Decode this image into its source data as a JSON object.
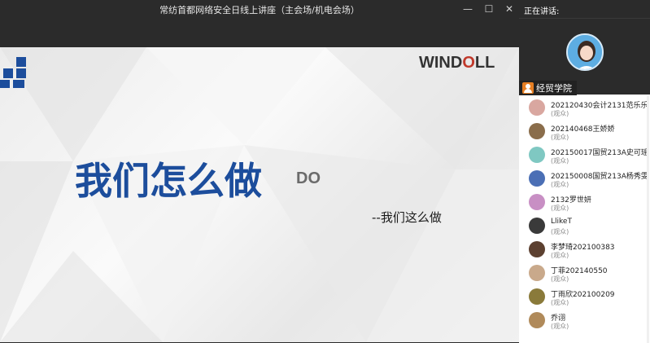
{
  "window": {
    "title": "常纺首都网络安全日线上讲座（主会场/机电会场）",
    "minimize_glyph": "—",
    "maximize_glyph": "☐",
    "close_glyph": "✕"
  },
  "slide": {
    "logo": {
      "prefix": "WIND",
      "accent": "O",
      "suffix": "LL"
    },
    "headline": "我们怎么做",
    "tag": "DO",
    "subtitle": "--我们这么做"
  },
  "panel": {
    "speaking_label": "正在讲话:",
    "speaker_name": "经贸学院",
    "audience": [
      {
        "name": "202120430会计2131范乐乐",
        "role": "(观众)",
        "color": "#d9a7a0"
      },
      {
        "name": "202140468王娇娇",
        "role": "(观众)",
        "color": "#8a6d4b"
      },
      {
        "name": "202150017国贸213A史可瑶",
        "role": "(观众)",
        "color": "#7fc8c2"
      },
      {
        "name": "202150008国贸213A杨秀雯",
        "role": "(观众)",
        "color": "#4b6fb5"
      },
      {
        "name": "2132罗世妍",
        "role": "(观众)",
        "color": "#c88fc4"
      },
      {
        "name": "LlikeT",
        "role": "(观众)",
        "color": "#3a3a3a"
      },
      {
        "name": "李梦琦202100383",
        "role": "(观众)",
        "color": "#5c4030"
      },
      {
        "name": "丁菲202140550",
        "role": "(观众)",
        "color": "#c9a98b"
      },
      {
        "name": "丁雨欣202100209",
        "role": "(观众)",
        "color": "#8a7a3a"
      },
      {
        "name": "乔诩",
        "role": "(观众)",
        "color": "#b08a5a"
      }
    ]
  },
  "colors": {
    "headline": "#1c4d9c",
    "logo_accent": "#c0392b",
    "speaker_tag_icon": "#e67e22"
  }
}
